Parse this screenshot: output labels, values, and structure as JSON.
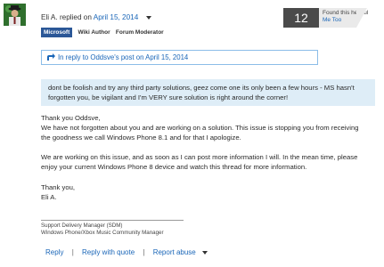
{
  "post": {
    "author": "Eli A.",
    "action_text": "replied on",
    "date": "April 15, 2014"
  },
  "badges": [
    "Microsoft",
    "Wiki Author",
    "Forum Moderator"
  ],
  "helpful": {
    "count": "12",
    "label": "Found this helpful",
    "me_too": "Me Too"
  },
  "reply_to": {
    "text": "In reply to Oddsve's post on April 15, 2014"
  },
  "quote": {
    "line1": "dont be foolish and try any third party solutions, geez come one its only been a few hours - MS hasn't",
    "line2": "forgotten you, be vigilant and I'm VERY sure solution is right around the corner!"
  },
  "body": {
    "p1_line1": "Thank you Oddsve,",
    "p1_line2": "We have not forgotten about you and are working on a solution.  This issue is stopping you from receiving",
    "p1_line3": "the goodness we call Windows Phone 8.1 and for that I apologize.",
    "p2_line1": "We are working on this issue, and as soon as I can post more information I will.  In the mean time, please",
    "p2_line2": "enjoy your current Windows Phone 8 device and watch this thread for more information.",
    "p3_line1": "Thank you,",
    "p3_line2": "Eli A."
  },
  "signature": {
    "line1": "Support Delivery Manager (SDM)",
    "line2": "Windows Phone/Xbox Music Community Manager"
  },
  "actions": {
    "reply": "Reply",
    "reply_with_quote": "Reply with quote",
    "report_abuse": "Report abuse",
    "separator": "|"
  },
  "colors": {
    "link": "#1a66b8",
    "badge_bg": "#2b5797",
    "quote_bg": "#deedf7",
    "counter_bg": "#4a4a4a"
  }
}
